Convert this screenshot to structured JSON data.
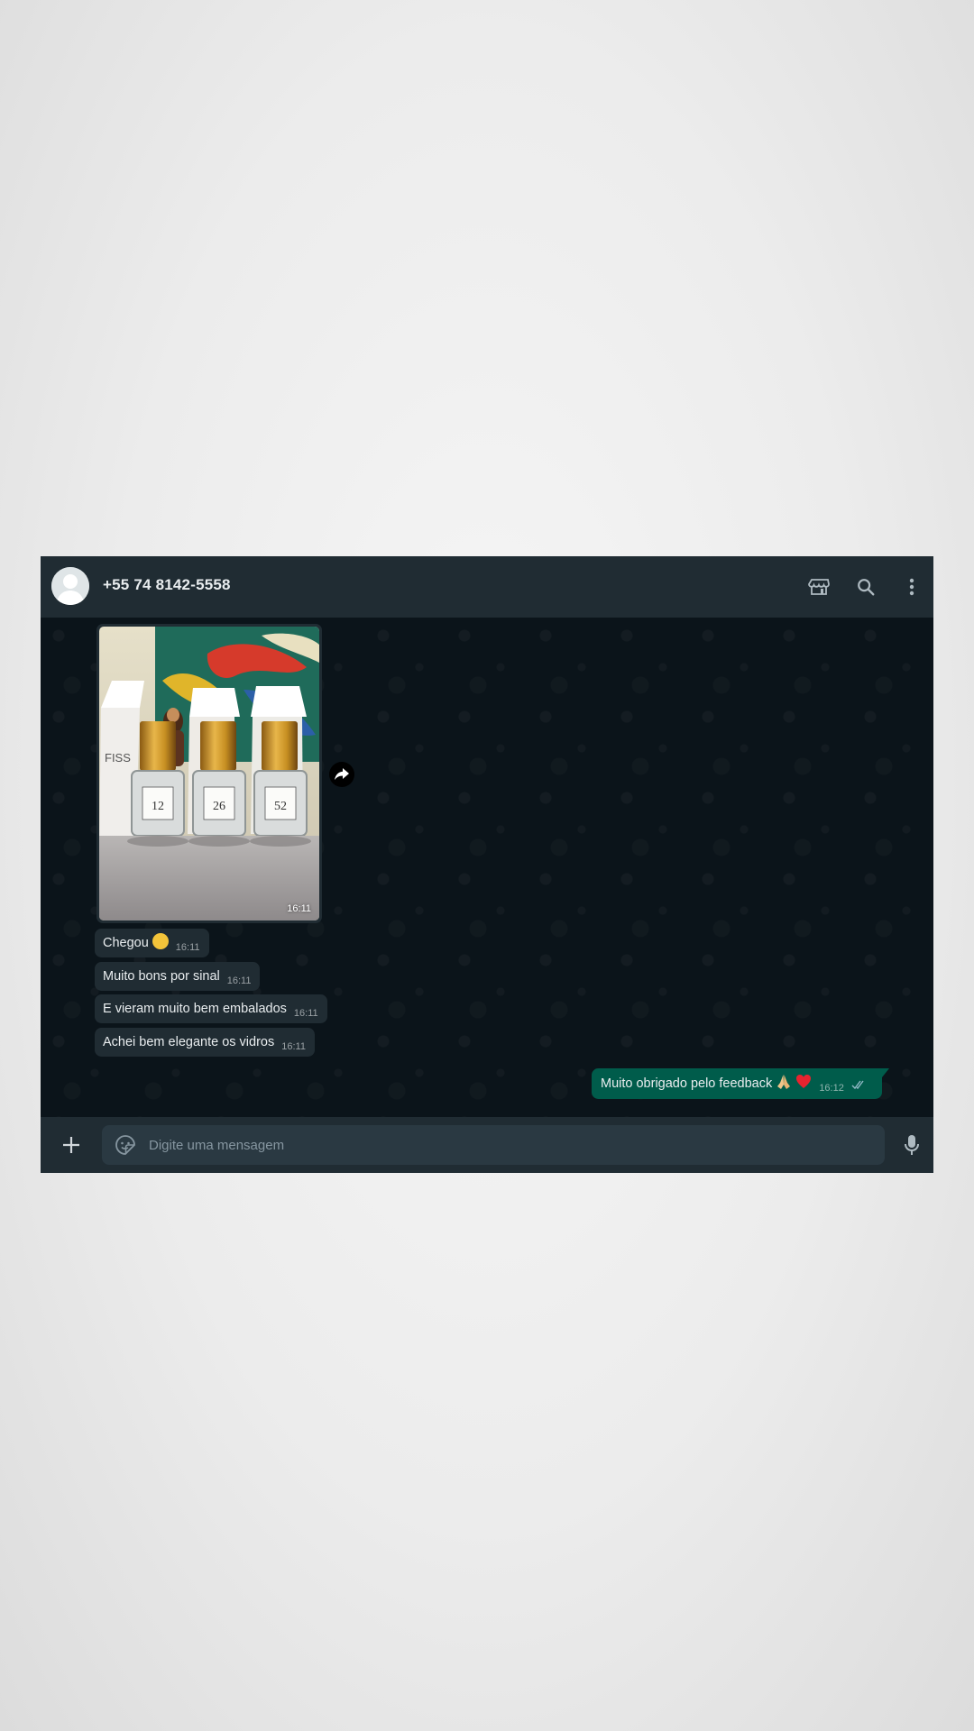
{
  "header": {
    "contact_name": "+55 74 8142-5558",
    "icons": [
      "avatar-placeholder",
      "store-icon",
      "search-icon",
      "menu-dots-icon"
    ]
  },
  "messages": {
    "incoming_image": {
      "time": "16:11",
      "labels": [
        "FISS",
        "12",
        "26",
        "52"
      ]
    },
    "incoming": [
      {
        "text": "Chegou",
        "emoji": "smiling-face-with-cowboy-hat",
        "time": "16:11"
      },
      {
        "text": "Muito bons por sinal",
        "time": "16:11"
      },
      {
        "text": "E vieram muito bem embalados",
        "time": "16:11"
      },
      {
        "text": "Achei bem elegante os vidros",
        "time": "16:11"
      }
    ],
    "outgoing": {
      "text": "Muito obrigado pelo feedback",
      "emojis": [
        "folded-hands",
        "red-heart"
      ],
      "time": "16:12",
      "status": "read"
    }
  },
  "footer": {
    "placeholder": "Digite uma mensagem",
    "icons": [
      "plus-icon",
      "sticker-icon",
      "mic-icon"
    ]
  },
  "colors": {
    "header_bg": "#202c33",
    "chat_bg": "#0b141a",
    "incoming_bubble": "#202c33",
    "outgoing_bubble": "#005c4b",
    "input_bg": "#2a3942",
    "read_ticks": "#53bdeb"
  }
}
